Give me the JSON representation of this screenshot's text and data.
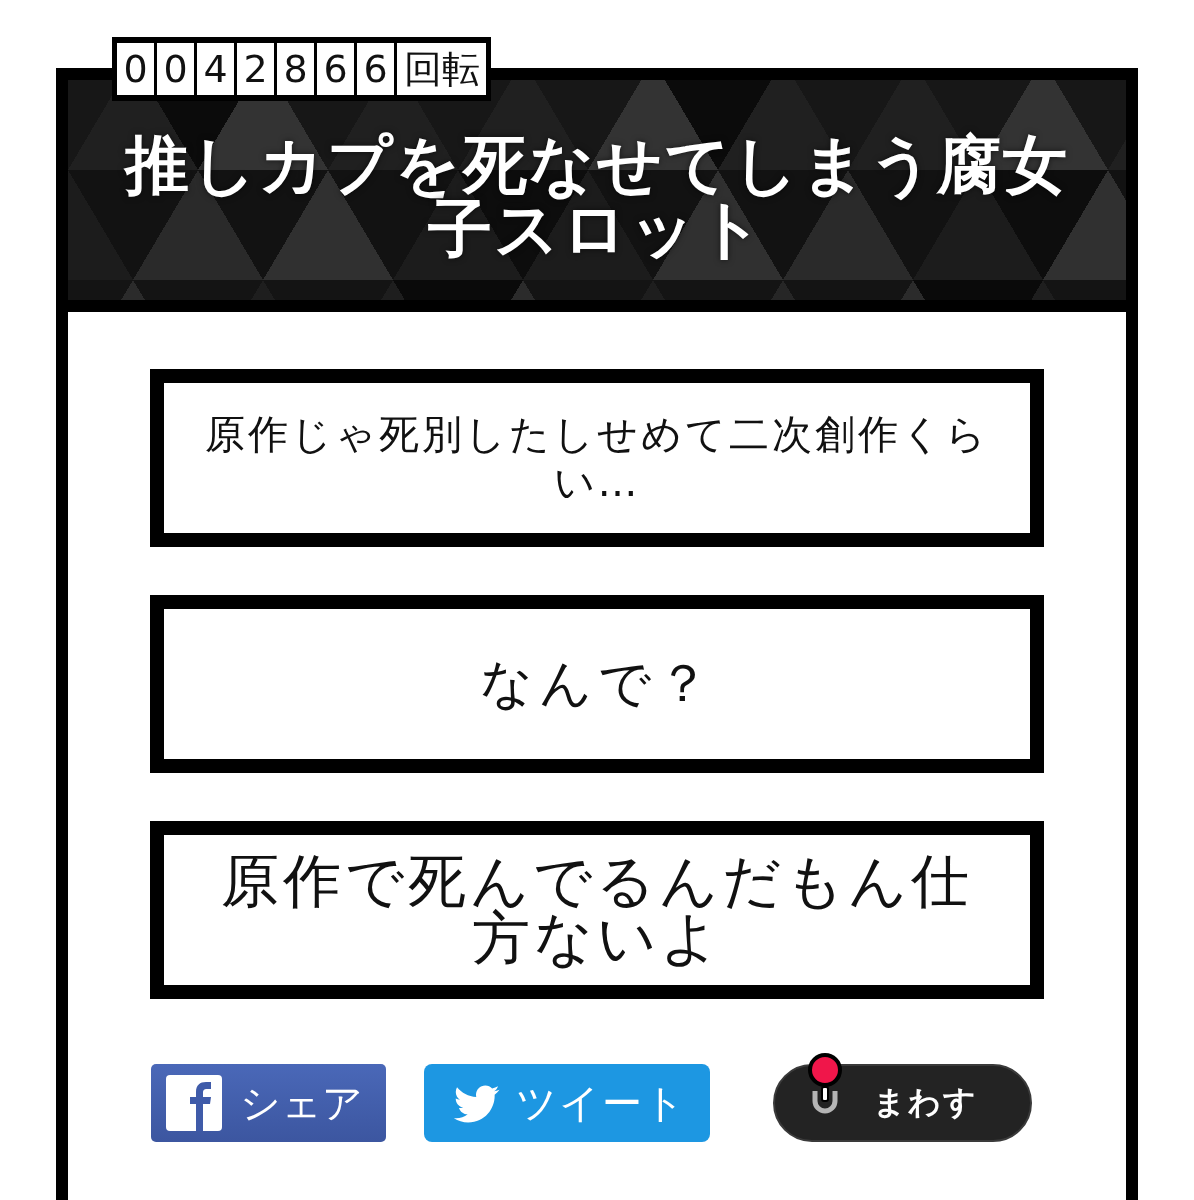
{
  "counter": {
    "digits": [
      "0",
      "0",
      "4",
      "2",
      "8",
      "6",
      "6"
    ],
    "unit": "回転"
  },
  "title": "推しカプを死なせてしまう腐女子スロット",
  "slots": [
    {
      "text": "原作じゃ死別したしせめて二次創作くらい…"
    },
    {
      "text": "なんで？"
    },
    {
      "text": "原作で死んでるんだもん仕方ないよ"
    }
  ],
  "buttons": [
    {
      "kind": "facebook",
      "label": "シェア"
    },
    {
      "kind": "twitter",
      "label": "ツイート"
    },
    {
      "kind": "spin",
      "label": "まわす"
    }
  ]
}
